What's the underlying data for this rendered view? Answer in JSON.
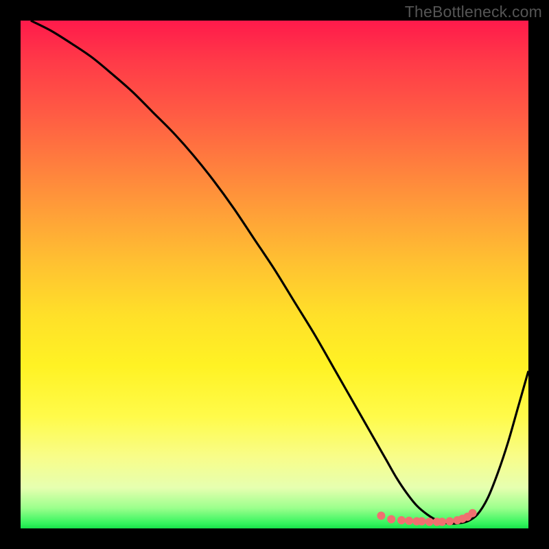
{
  "watermark": "TheBottleneck.com",
  "chart_data": {
    "type": "line",
    "title": "",
    "xlabel": "",
    "ylabel": "",
    "xlim": [
      0,
      100
    ],
    "ylim": [
      0,
      100
    ],
    "curve": {
      "name": "bottleneck-curve",
      "x": [
        2,
        6,
        10,
        14,
        18,
        22,
        26,
        30,
        34,
        38,
        42,
        46,
        50,
        54,
        58,
        62,
        64,
        66,
        68,
        70,
        72,
        74,
        76,
        78,
        80,
        82,
        84,
        86,
        88,
        90,
        92,
        94,
        96,
        98,
        100
      ],
      "y": [
        100,
        98,
        95.5,
        92.8,
        89.5,
        86,
        82,
        78,
        73.5,
        68.5,
        63,
        57,
        51,
        44.5,
        38,
        31,
        27.5,
        24,
        20.5,
        17,
        13.5,
        10,
        7,
        4.5,
        2.8,
        1.6,
        1.0,
        1.0,
        1.4,
        2.8,
        6,
        11,
        17,
        24,
        31
      ]
    },
    "markers": {
      "name": "bottom-cluster",
      "color": "#f07070",
      "points": [
        {
          "x": 71,
          "y": 2.5
        },
        {
          "x": 73,
          "y": 1.8
        },
        {
          "x": 75,
          "y": 1.6
        },
        {
          "x": 76.5,
          "y": 1.5
        },
        {
          "x": 78,
          "y": 1.4
        },
        {
          "x": 79,
          "y": 1.4
        },
        {
          "x": 80.5,
          "y": 1.3
        },
        {
          "x": 82,
          "y": 1.3
        },
        {
          "x": 83,
          "y": 1.3
        },
        {
          "x": 84.5,
          "y": 1.4
        },
        {
          "x": 86,
          "y": 1.6
        },
        {
          "x": 87,
          "y": 1.9
        },
        {
          "x": 88,
          "y": 2.3
        },
        {
          "x": 89,
          "y": 3.0
        }
      ]
    }
  }
}
